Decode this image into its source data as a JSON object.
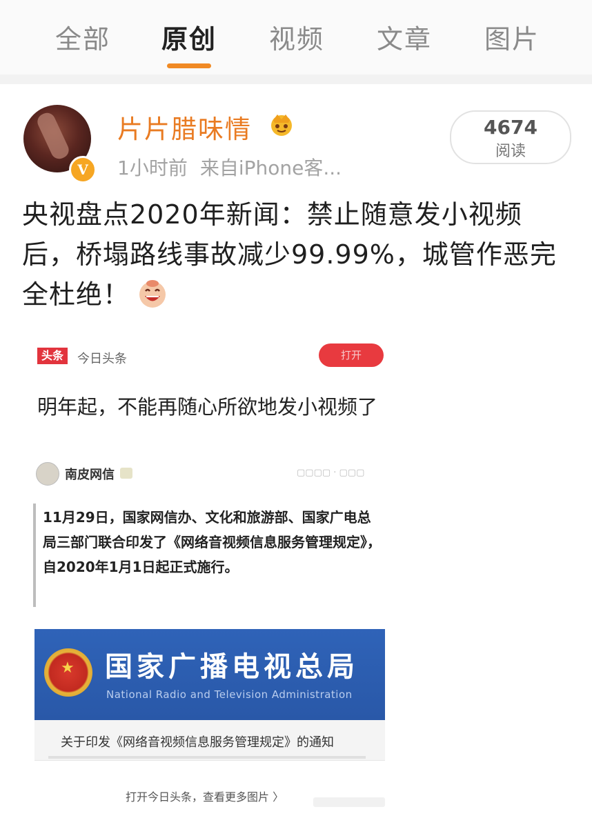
{
  "tabs": {
    "items": [
      {
        "label": "全部"
      },
      {
        "label": "原创"
      },
      {
        "label": "视频"
      },
      {
        "label": "文章"
      },
      {
        "label": "图片"
      }
    ],
    "active_index": 1,
    "accent_color": "#f08a24"
  },
  "post": {
    "username": "片片腊味情",
    "username_color": "#e97b22",
    "verified_badge": "V",
    "time": "1小时前",
    "source": "来自iPhone客...",
    "reads_count": "4674",
    "reads_label": "阅读",
    "text": "央视盘点2020年新闻：禁止随意发小视频后，桥塌路线事故减少99.99%，城管作恶完全杜绝！",
    "emoji": "grin-emoji"
  },
  "embedded": {
    "source_logo": "头条",
    "source_name": "今日头条",
    "open_button": "打开",
    "article_title": "明年起，不能再随心所欲地发小视频了",
    "author": "南皮网信",
    "quote": "11月29日，国家网信办、文化和旅游部、国家广电总局三部门联合印发了《网络音视频信息服务管理规定》，自2020年1月1日起正式施行。",
    "banner_cn": "国家广播电视总局",
    "banner_en": "National Radio and Television Administration",
    "notice": "关于印发《网络音视频信息服务管理规定》的通知",
    "more_link": "打开今日头条，查看更多图片 〉"
  }
}
